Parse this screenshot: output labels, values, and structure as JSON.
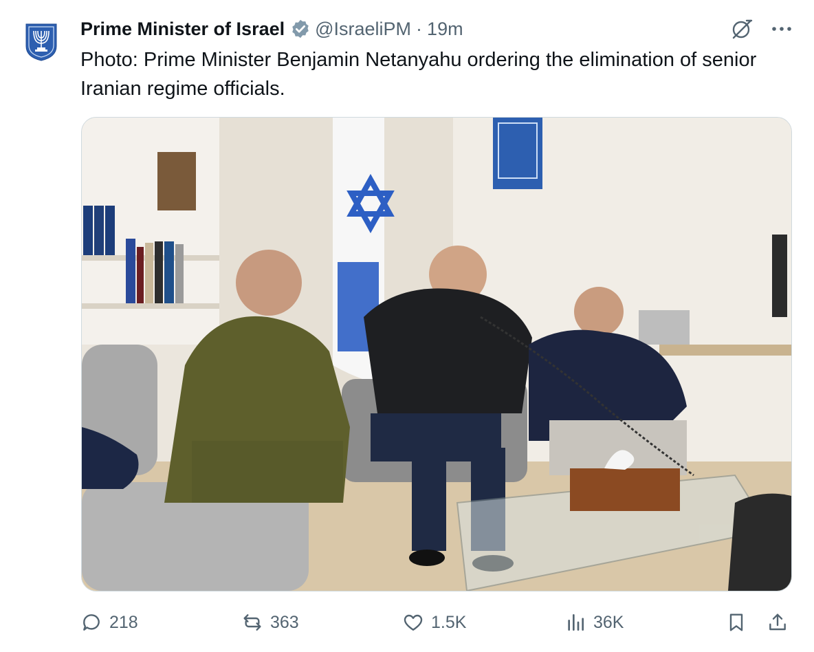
{
  "tweet": {
    "author_name": "Prime Minister of Israel",
    "handle": "@IsraeliPM",
    "separator": "·",
    "time": "19m",
    "text": "Photo: Prime Minister Benjamin Netanyahu ordering the elimination of senior Iranian regime officials.",
    "verified_badge_color": "#829aab",
    "avatar_color": "#2d5fb0"
  },
  "media": {
    "type": "photo"
  },
  "actions": {
    "replies": "218",
    "reposts": "363",
    "likes": "1.5K",
    "views": "36K"
  },
  "icons": [
    "menorah-avatar-icon",
    "verified-badge-icon",
    "grok-icon",
    "more-icon",
    "reply-icon",
    "repost-icon",
    "like-icon",
    "views-icon",
    "bookmark-icon",
    "share-icon"
  ]
}
